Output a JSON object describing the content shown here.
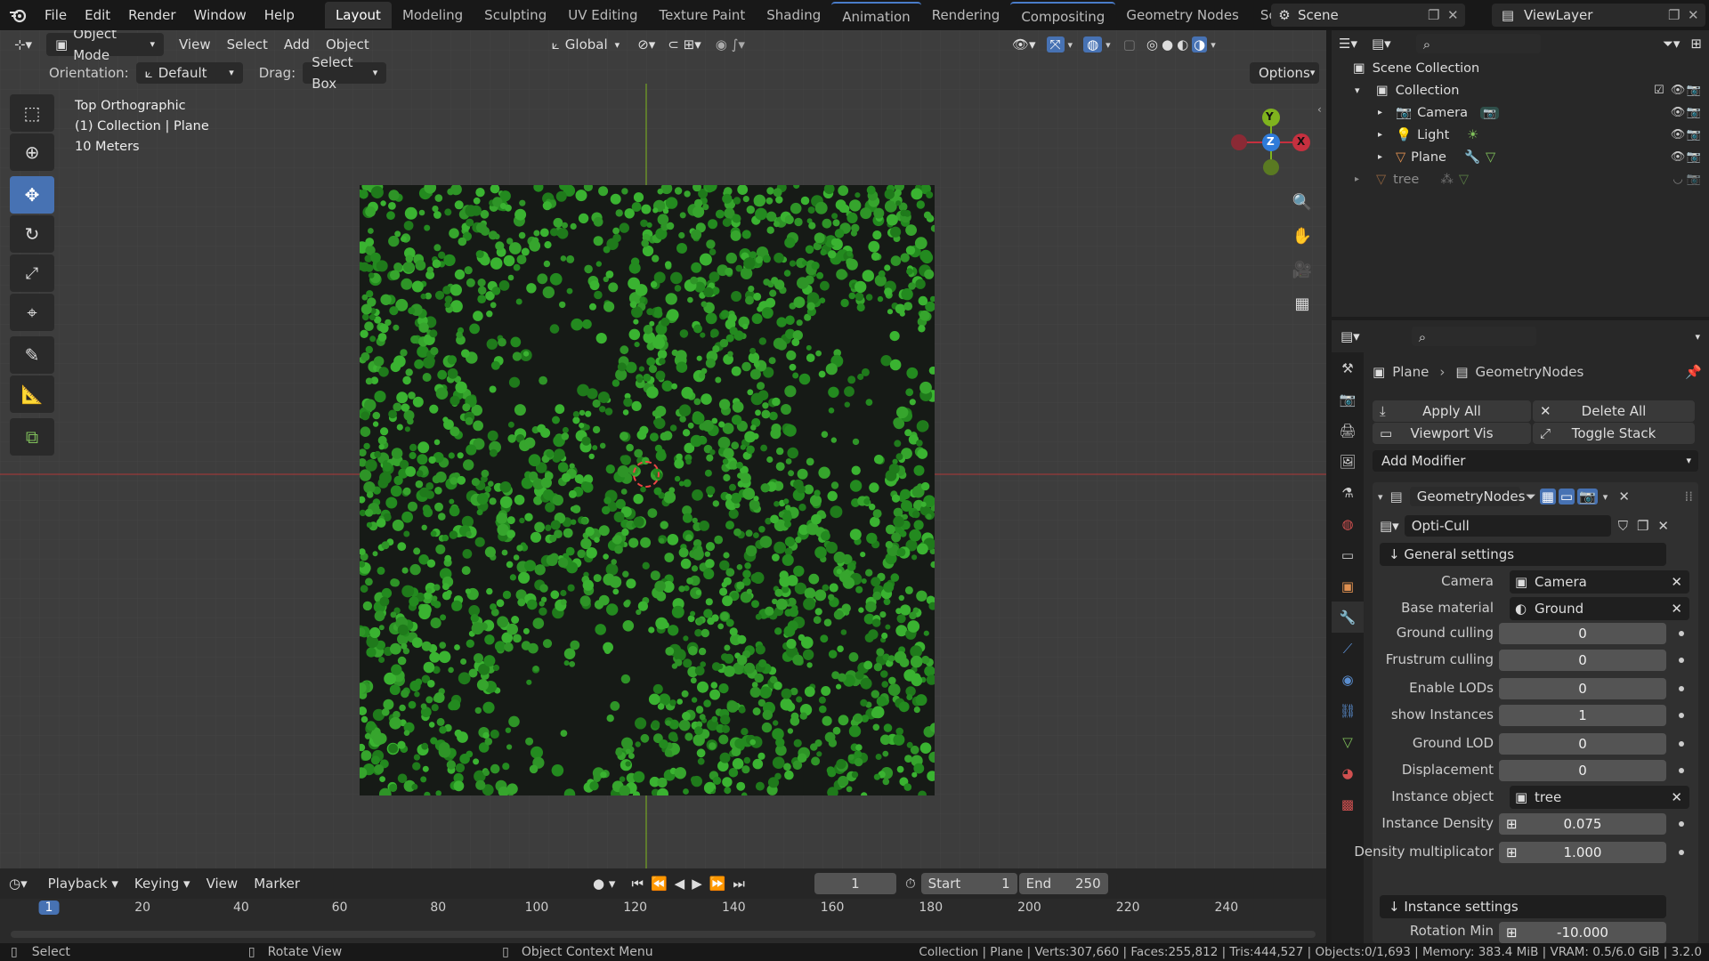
{
  "topbar": {
    "menus": [
      "File",
      "Edit",
      "Render",
      "Window",
      "Help"
    ],
    "workspaces": [
      "Layout",
      "Modeling",
      "Sculpting",
      "UV Editing",
      "Texture Paint",
      "Shading",
      "Animation",
      "Rendering",
      "Compositing",
      "Geometry Nodes",
      "Scripting"
    ],
    "add_tab": "+",
    "scene_label": "Scene",
    "viewlayer_label": "ViewLayer"
  },
  "viewport_header": {
    "mode": "Object Mode",
    "menus": [
      "View",
      "Select",
      "Add",
      "Object"
    ],
    "transform_orientation": "Global"
  },
  "tool_settings": {
    "orientation_label": "Orientation:",
    "orientation_value": "Default",
    "drag_label": "Drag:",
    "drag_value": "Select Box",
    "options_label": "Options"
  },
  "viewport_info": {
    "view_name": "Top Orthographic",
    "collection_info": "(1) Collection | Plane",
    "scale": "10 Meters"
  },
  "gizmo": {
    "y": "Y",
    "z": "Z",
    "x": "X"
  },
  "outliner": {
    "root": "Scene Collection",
    "collection": "Collection",
    "items": [
      {
        "name": "Camera",
        "icon": "camera-object-icon"
      },
      {
        "name": "Light",
        "icon": "light-object-icon"
      },
      {
        "name": "Plane",
        "icon": "mesh-object-icon"
      },
      {
        "name": "tree",
        "icon": "mesh-object-icon"
      }
    ]
  },
  "properties": {
    "breadcrumb_object": "Plane",
    "breadcrumb_modifier": "GeometryNodes",
    "apply_all": "Apply All",
    "delete_all": "Delete All",
    "viewport_vis": "Viewport Vis",
    "toggle_stack": "Toggle Stack",
    "add_modifier": "Add Modifier",
    "modifier_name": "GeometryNodes",
    "node_group": "Opti-Cull",
    "general_settings": "↓ General settings",
    "instance_settings": "↓ Instance settings",
    "fields": [
      {
        "label": "Camera",
        "kind": "object",
        "value": "Camera"
      },
      {
        "label": "Base material",
        "kind": "material",
        "value": "Ground"
      },
      {
        "label": "Ground culling",
        "kind": "number",
        "value": "0"
      },
      {
        "label": "Frustrum culling",
        "kind": "number",
        "value": "0"
      },
      {
        "label": "Enable LODs",
        "kind": "number",
        "value": "0"
      },
      {
        "label": "show Instances",
        "kind": "number",
        "value": "1"
      },
      {
        "label": "Ground LOD",
        "kind": "number",
        "value": "0"
      },
      {
        "label": "Displacement",
        "kind": "number",
        "value": "0"
      },
      {
        "label": "Instance object",
        "kind": "object",
        "value": "tree"
      },
      {
        "label": "Instance Density",
        "kind": "slider",
        "value": "0.075"
      },
      {
        "label": "Density multiplicator",
        "kind": "slider",
        "value": "1.000"
      }
    ],
    "rotation_min_label": "Rotation Min",
    "rotation_min_value": "-10.000"
  },
  "timeline": {
    "menus": [
      "Playback",
      "Keying",
      "View",
      "Marker"
    ],
    "current_frame": "1",
    "start_label": "Start",
    "start_value": "1",
    "end_label": "End",
    "end_value": "250",
    "ticks": [
      "1",
      "20",
      "40",
      "60",
      "80",
      "100",
      "120",
      "140",
      "160",
      "180",
      "200",
      "220",
      "240"
    ]
  },
  "statusbar": {
    "select": "Select",
    "rotate": "Rotate View",
    "context": "Object Context Menu",
    "stats": "Collection | Plane | Verts:307,660 | Faces:255,812 | Tris:444,527 | Objects:0/1,693 | Memory: 383.4 MiB | VRAM: 0.5/6.0 GiB | 3.2.0"
  },
  "colors": {
    "accent": "#4772b3",
    "active_tool": "#4772b3",
    "axis_x": "#c5303f",
    "axis_y": "#7fb31e",
    "axis_z": "#2f7bd9",
    "foliage": "#2b8a24"
  }
}
